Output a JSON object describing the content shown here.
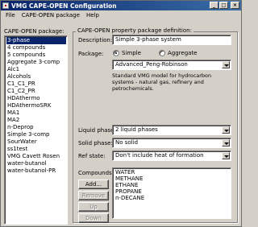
{
  "window": {
    "title": "VMG CAPE-OPEN Configuration"
  },
  "menu": [
    "File",
    "CAPE-OPEN package",
    "Help"
  ],
  "packages": {
    "label": "CAPE-OPEN package:",
    "items": [
      "3-phase",
      "4 compounds",
      "5 compounds",
      "Aggregate 3-comp",
      "Alc1",
      "Alcohols",
      "C1_C1_PR",
      "C1_C2_PR",
      "HDAthermo",
      "HDAthermoSRK",
      "MA1",
      "MA2",
      "n-Deprop",
      "Simple 3-comp",
      "SourWater",
      "ss1test",
      "VMG Cavett Rosen",
      "water-butanol",
      "water-butanol-PR"
    ],
    "selected_index": 0
  },
  "definition": {
    "group_title": "CAPE-OPEN property package definition:",
    "description_label": "Description:",
    "description_value": "Simple 3-phase system",
    "package_label": "Package:",
    "radio_simple": "Simple",
    "radio_aggregate": "Aggregate",
    "package_selected": "simple",
    "package_value": "Advanced_Peng-Robinson",
    "package_description": "Standard VMG model for hydrocarbon systems - natural gas, refinery and petrochemicals.",
    "liquid_label": "Liquid phases:",
    "liquid_value": "2 liquid phases",
    "solid_label": "Solid phase:",
    "solid_value": "No solid",
    "ref_label": "Ref state:",
    "ref_value": "Don't include heat of formation",
    "compounds_label": "Compounds:",
    "compounds": [
      "WATER",
      "METHANE",
      "ETHANE",
      "PROPANE",
      "n-DECANE"
    ],
    "buttons": {
      "add": "Add...",
      "remove": "Remove",
      "up": "Up",
      "down": "Down"
    }
  }
}
